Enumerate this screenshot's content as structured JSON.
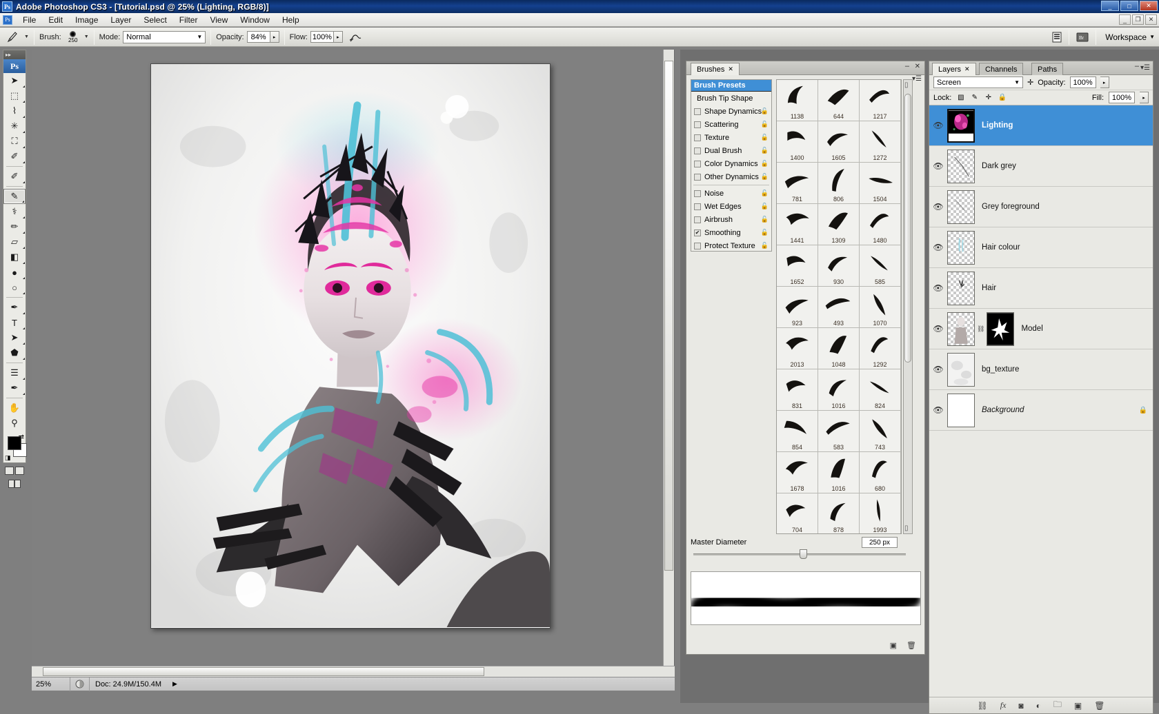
{
  "window": {
    "title": "Adobe Photoshop CS3 - [Tutorial.psd @ 25% (Lighting, RGB/8)]",
    "app_icon": "Ps",
    "minimize": "_",
    "maximize": "□",
    "close": "✕",
    "doc_minimize": "_",
    "doc_restore": "❐",
    "doc_close": "✕"
  },
  "menu": {
    "doc_icon": "Ps",
    "items": [
      "File",
      "Edit",
      "Image",
      "Layer",
      "Select",
      "Filter",
      "View",
      "Window",
      "Help"
    ]
  },
  "options_bar": {
    "tool_icon": "brush-tool-icon",
    "brush_label": "Brush:",
    "brush_size": "250",
    "mode_label": "Mode:",
    "mode_value": "Normal",
    "opacity_label": "Opacity:",
    "opacity_value": "84%",
    "flow_label": "Flow:",
    "flow_value": "100%",
    "airbrush_icon": "airbrush-icon",
    "palette_toggle_icon": "palettes-icon",
    "bridge_icon": "bridge-icon",
    "workspace_label": "Workspace"
  },
  "tools": [
    {
      "name": "move-tool",
      "glyph": "➤",
      "sub": true
    },
    {
      "name": "marquee-tool",
      "glyph": "⬚",
      "sub": true
    },
    {
      "name": "lasso-tool",
      "glyph": "⌇",
      "sub": true
    },
    {
      "name": "magic-wand-tool",
      "glyph": "✳",
      "sub": true
    },
    {
      "name": "crop-tool",
      "glyph": "⛶",
      "sub": true
    },
    {
      "name": "slice-tool",
      "glyph": "✐",
      "sub": true
    },
    {
      "name": "healing-brush-tool",
      "glyph": "✐",
      "sub": true
    },
    {
      "name": "brush-tool",
      "glyph": "✎",
      "sub": true,
      "selected": true
    },
    {
      "name": "clone-stamp-tool",
      "glyph": "⚕",
      "sub": true
    },
    {
      "name": "history-brush-tool",
      "glyph": "✏",
      "sub": true
    },
    {
      "name": "eraser-tool",
      "glyph": "▱",
      "sub": true
    },
    {
      "name": "gradient-tool",
      "glyph": "◧",
      "sub": true
    },
    {
      "name": "blur-tool",
      "glyph": "●",
      "sub": true
    },
    {
      "name": "dodge-tool",
      "glyph": "○",
      "sub": true
    },
    {
      "name": "pen-tool",
      "glyph": "✒",
      "sub": true
    },
    {
      "name": "type-tool",
      "glyph": "T",
      "sub": true
    },
    {
      "name": "path-selection-tool",
      "glyph": "➤",
      "sub": true
    },
    {
      "name": "shape-tool",
      "glyph": "⬟",
      "sub": true
    },
    {
      "name": "notes-tool",
      "glyph": "☰",
      "sub": true
    },
    {
      "name": "eyedropper-tool",
      "glyph": "✒",
      "sub": true
    },
    {
      "name": "hand-tool",
      "glyph": "✋",
      "sub": false
    },
    {
      "name": "zoom-tool",
      "glyph": "⚲",
      "sub": false
    }
  ],
  "color_chips": {
    "foreground": "#000000",
    "background": "#ffffff",
    "swap_icon": "swap-colors-icon",
    "default_icon": "default-colors-icon"
  },
  "document": {
    "zoom": "25%",
    "doc_info": "Doc: 24.9M/150.4M",
    "status_arrow": "▶"
  },
  "brushes_panel": {
    "tab_label": "Brushes",
    "tab_close": "✕",
    "minimize": "–",
    "close": "✕",
    "menu_icon": "panel-menu-icon",
    "options": [
      {
        "label": "Brush Presets",
        "type": "header"
      },
      {
        "label": "Brush Tip Shape",
        "type": "plain"
      },
      {
        "label": "Shape Dynamics",
        "type": "check",
        "checked": false,
        "lock": true
      },
      {
        "label": "Scattering",
        "type": "check",
        "checked": false,
        "lock": true
      },
      {
        "label": "Texture",
        "type": "check",
        "checked": false,
        "lock": true
      },
      {
        "label": "Dual Brush",
        "type": "check",
        "checked": false,
        "lock": true
      },
      {
        "label": "Color Dynamics",
        "type": "check",
        "checked": false,
        "lock": true
      },
      {
        "label": "Other Dynamics",
        "type": "check",
        "checked": false,
        "lock": true
      },
      {
        "label": "Noise",
        "type": "check",
        "checked": false,
        "lock": true,
        "gap": true
      },
      {
        "label": "Wet Edges",
        "type": "check",
        "checked": false,
        "lock": true
      },
      {
        "label": "Airbrush",
        "type": "check",
        "checked": false,
        "lock": true
      },
      {
        "label": "Smoothing",
        "type": "check",
        "checked": true,
        "lock": true
      },
      {
        "label": "Protect Texture",
        "type": "check",
        "checked": false,
        "lock": true
      }
    ],
    "preset_rows": [
      [
        "1138",
        "644",
        "1217"
      ],
      [
        "1400",
        "1605",
        "1272"
      ],
      [
        "781",
        "806",
        "1504"
      ],
      [
        "1441",
        "1309",
        "1480"
      ],
      [
        "1652",
        "930",
        "585"
      ],
      [
        "923",
        "493",
        "1070"
      ],
      [
        "2013",
        "1048",
        "1292"
      ],
      [
        "831",
        "1016",
        "824"
      ],
      [
        "854",
        "583",
        "743"
      ],
      [
        "1678",
        "1016",
        "680"
      ],
      [
        "704",
        "878",
        "1993"
      ]
    ],
    "master_diameter_label": "Master Diameter",
    "master_diameter_value": "250 px",
    "footer_icons": [
      "new-brush-icon",
      "delete-brush-icon"
    ]
  },
  "layers_panel": {
    "tabs": [
      {
        "label": "Layers",
        "active": true,
        "close": "✕"
      },
      {
        "label": "Channels",
        "active": false
      },
      {
        "label": "Paths",
        "active": false
      }
    ],
    "minimize": "–",
    "menu_icon": "panel-menu-icon",
    "blend_mode": "Screen",
    "opacity_label": "Opacity:",
    "opacity_value": "100%",
    "lock_label": "Lock:",
    "lock_icons": [
      "lock-transparency-icon",
      "lock-image-icon",
      "lock-position-icon",
      "lock-all-icon"
    ],
    "fill_label": "Fill:",
    "fill_value": "100%",
    "layers": [
      {
        "name": "Lighting",
        "visible": true,
        "selected": true,
        "thumb": "lighting",
        "italic": false
      },
      {
        "name": "Dark grey",
        "visible": true,
        "selected": false,
        "thumb": "transparent-strokes",
        "italic": false
      },
      {
        "name": "Grey foreground",
        "visible": true,
        "selected": false,
        "thumb": "transparent-faint",
        "italic": false
      },
      {
        "name": "Hair colour",
        "visible": true,
        "selected": false,
        "thumb": "transparent-cyan",
        "italic": false
      },
      {
        "name": "Hair",
        "visible": true,
        "selected": false,
        "thumb": "transparent-hair",
        "italic": false
      },
      {
        "name": "Model",
        "visible": true,
        "selected": false,
        "thumb": "model",
        "mask": true,
        "italic": false
      },
      {
        "name": "bg_texture",
        "visible": true,
        "selected": false,
        "thumb": "bgtexture",
        "italic": false
      },
      {
        "name": "Background",
        "visible": true,
        "selected": false,
        "thumb": "white",
        "italic": true,
        "locked": true
      }
    ],
    "footer_icons": [
      "link-layers-icon",
      "layer-style-fx-icon",
      "layer-mask-icon",
      "adjustment-layer-icon",
      "new-group-icon",
      "new-layer-icon",
      "delete-layer-icon"
    ],
    "footer_fx": "fx"
  },
  "colors": {
    "accent_blue": "#3f8fd6",
    "title_blue": "#14418f",
    "panel_bg": "#e9e9e4",
    "canvas_gray": "#808080",
    "magenta": "#e0339b",
    "cyan": "#4fc4d8"
  }
}
